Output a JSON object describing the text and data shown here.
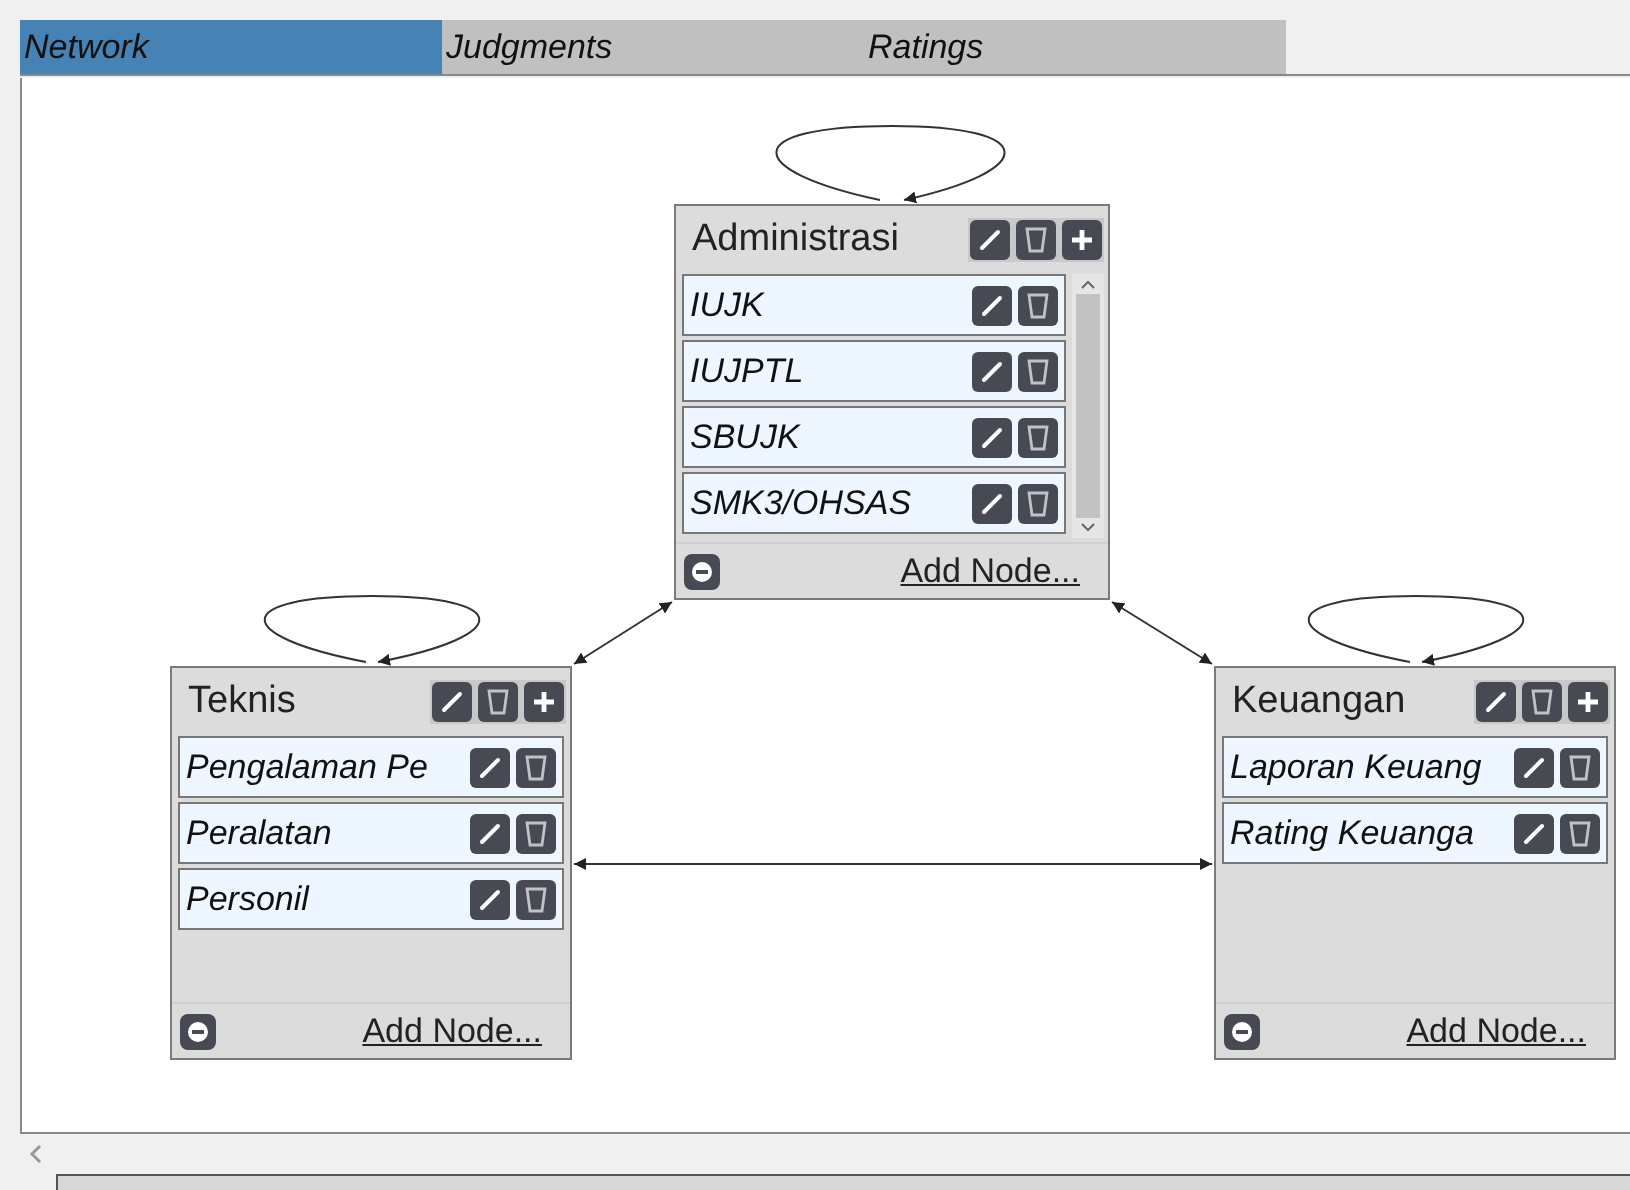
{
  "tabs": [
    {
      "label": "Network",
      "selected": true
    },
    {
      "label": "Judgments",
      "selected": false
    },
    {
      "label": "Ratings",
      "selected": false
    }
  ],
  "clusters": [
    {
      "title": "Administrasi",
      "scrollable": true,
      "add_label": "Add Node...",
      "items": [
        {
          "label": "IUJK"
        },
        {
          "label": "IUJPTL"
        },
        {
          "label": "SBUJK"
        },
        {
          "label": "SMK3/OHSAS"
        }
      ]
    },
    {
      "title": "Teknis",
      "scrollable": false,
      "add_label": "Add Node...",
      "items": [
        {
          "label": "Pengalaman Pe"
        },
        {
          "label": "Peralatan"
        },
        {
          "label": "Personil"
        }
      ]
    },
    {
      "title": "Keuangan",
      "scrollable": false,
      "add_label": "Add Node...",
      "items": [
        {
          "label": "Laporan Keuang"
        },
        {
          "label": "Rating Keuanga"
        }
      ]
    }
  ]
}
